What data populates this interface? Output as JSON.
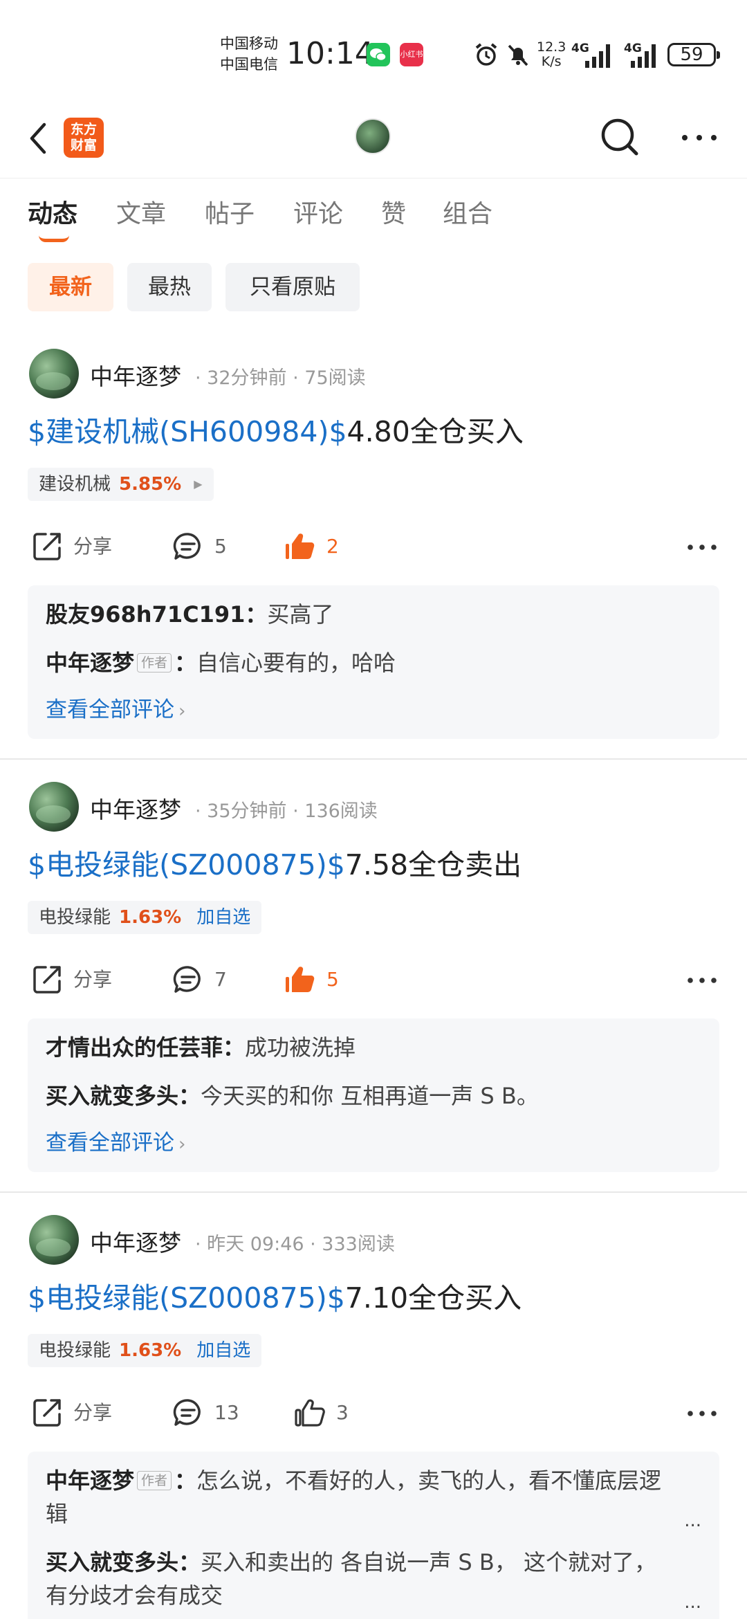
{
  "status_bar": {
    "carrier1": "中国移动",
    "carrier2": "中国电信",
    "time": "10:14",
    "app_badge_text": "小红书",
    "net_speed_value": "12.3",
    "net_speed_unit": "K/s",
    "signal1_label": "4G",
    "signal2_label": "4G",
    "battery": "59"
  },
  "nav": {
    "logo_line1": "东方",
    "logo_line2": "财富"
  },
  "tabs": [
    {
      "label": "动态",
      "active": true
    },
    {
      "label": "文章",
      "active": false
    },
    {
      "label": "帖子",
      "active": false
    },
    {
      "label": "评论",
      "active": false
    },
    {
      "label": "赞",
      "active": false
    },
    {
      "label": "组合",
      "active": false
    }
  ],
  "filters": [
    {
      "label": "最新",
      "active": true
    },
    {
      "label": "最热",
      "active": false
    },
    {
      "label": "只看原贴",
      "active": false
    }
  ],
  "posts": [
    {
      "author": "中年逐梦",
      "meta": "· 32分钟前 · 75阅读",
      "title_link": "$建设机械(SH600984)$",
      "title_rest": "4.80全仓买入",
      "tag_name": "建设机械",
      "tag_pct": "5.85%",
      "tag_extra": "",
      "share_label": "分享",
      "comment_count": "5",
      "like_count": "2",
      "liked": true,
      "comments": [
        {
          "author": "股友968h71C191",
          "is_op": false,
          "text": "买高了"
        },
        {
          "author": "中年逐梦",
          "is_op": true,
          "text": "自信心要有的，哈哈"
        }
      ],
      "view_all": "查看全部评论"
    },
    {
      "author": "中年逐梦",
      "meta": "· 35分钟前 · 136阅读",
      "title_link": "$电投绿能(SZ000875)$",
      "title_rest": "7.58全仓卖出",
      "tag_name": "电投绿能",
      "tag_pct": "1.63%",
      "tag_extra": "加自选",
      "share_label": "分享",
      "comment_count": "7",
      "like_count": "5",
      "liked": true,
      "comments": [
        {
          "author": "才情出众的任芸菲",
          "is_op": false,
          "text": "成功被洗掉"
        },
        {
          "author": "买入就变多头",
          "is_op": false,
          "text": "今天买的和你 互相再道一声 S B。"
        }
      ],
      "view_all": "查看全部评论"
    },
    {
      "author": "中年逐梦",
      "meta": "· 昨天 09:46 · 333阅读",
      "title_link": "$电投绿能(SZ000875)$",
      "title_rest": "7.10全仓买入",
      "tag_name": "电投绿能",
      "tag_pct": "1.63%",
      "tag_extra": "加自选",
      "share_label": "分享",
      "comment_count": "13",
      "like_count": "3",
      "liked": false,
      "comments": [
        {
          "author": "中年逐梦",
          "is_op": true,
          "text": "怎么说，不看好的人，卖飞的人，看不懂底层逻辑",
          "more": "..."
        },
        {
          "author": "买入就变多头",
          "is_op": false,
          "text": "买入和卖出的 各自说一声 S B， 这个就对了，有分歧才会有成交",
          "more": "..."
        }
      ],
      "view_all": ""
    }
  ],
  "op_badge": "作者",
  "colors": {
    "accent": "#f2631c",
    "link": "#1a6fc7",
    "up_red": "#e0501a"
  }
}
